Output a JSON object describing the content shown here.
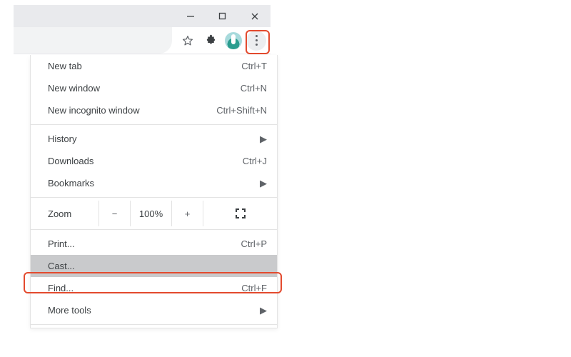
{
  "toolbar": {
    "star_title": "Bookmark this tab",
    "extensions_title": "Extensions",
    "profile_title": "Profile",
    "menu_title": "Customize and control Google Chrome"
  },
  "menu": {
    "section1": [
      {
        "label": "New tab",
        "shortcut": "Ctrl+T"
      },
      {
        "label": "New window",
        "shortcut": "Ctrl+N"
      },
      {
        "label": "New incognito window",
        "shortcut": "Ctrl+Shift+N"
      }
    ],
    "section2": [
      {
        "label": "History",
        "submenu": true
      },
      {
        "label": "Downloads",
        "shortcut": "Ctrl+J"
      },
      {
        "label": "Bookmarks",
        "submenu": true
      }
    ],
    "zoom": {
      "label": "Zoom",
      "minus": "−",
      "pct": "100%",
      "plus": "+"
    },
    "section3": [
      {
        "label": "Print...",
        "shortcut": "Ctrl+P"
      },
      {
        "label": "Cast...",
        "selected": true
      },
      {
        "label": "Find...",
        "shortcut": "Ctrl+F"
      },
      {
        "label": "More tools",
        "submenu": true
      }
    ]
  },
  "highlights": {
    "kebab": "kebab button highlighted",
    "cast": "cast menu item highlighted"
  }
}
